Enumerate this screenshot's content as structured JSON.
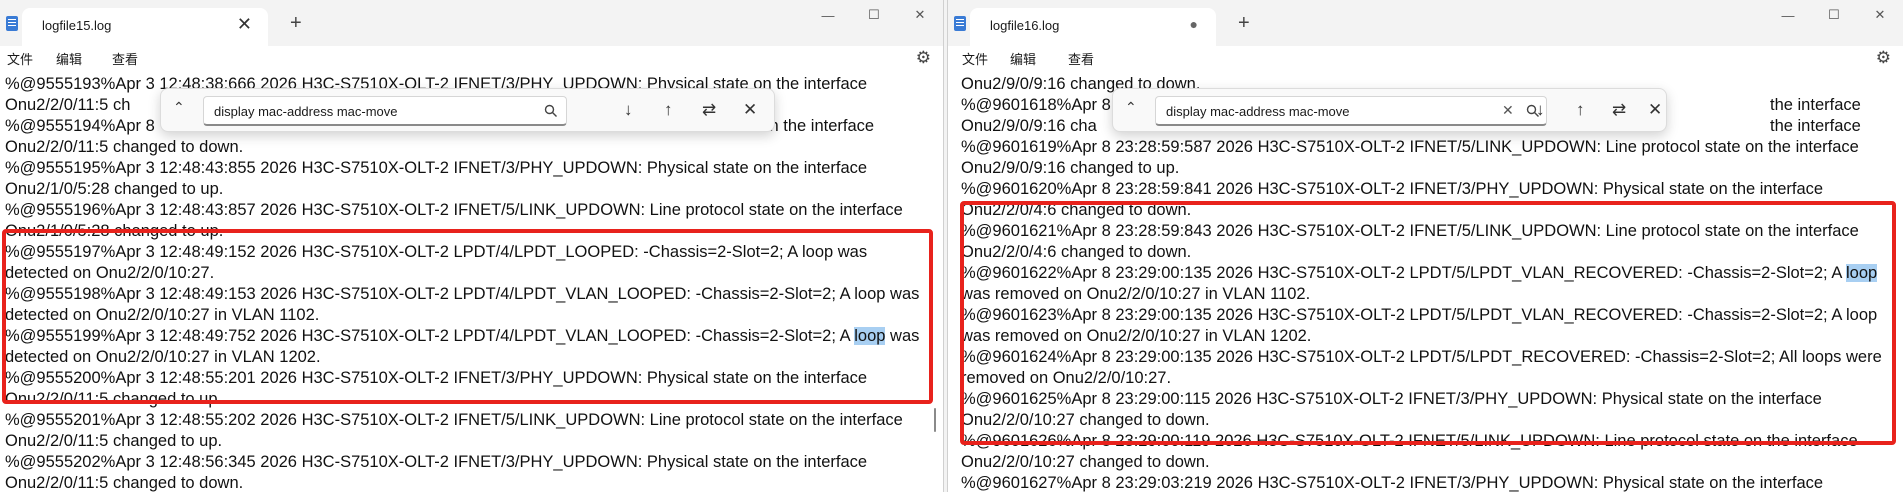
{
  "left": {
    "tab_title": "logfile15.log",
    "tab_close": "✕",
    "new_tab": "+",
    "menu": [
      "文件",
      "编辑",
      "查看"
    ],
    "find_query": "display mac-address mac-move",
    "lines": [
      "%@9555193%Apr  3 12:48:38:666 2026 H3C-S7510X-OLT-2 IFNET/3/PHY_UPDOWN: Physical state on the interface",
      "Onu2/2/0/11:5 ch",
      "%@9555194%Apr  8",
      "Onu2/2/0/11:5 changed to down.",
      "%@9555195%Apr  3 12:48:43:855 2026 H3C-S7510X-OLT-2 IFNET/3/PHY_UPDOWN: Physical state on the interface",
      "Onu2/1/0/5:28 changed to up.",
      "%@9555196%Apr  3 12:48:43:857 2026 H3C-S7510X-OLT-2 IFNET/5/LINK_UPDOWN: Line protocol state on the interface",
      "Onu2/1/0/5:28 changed to up.",
      "%@9555197%Apr  3 12:48:49:152 2026 H3C-S7510X-OLT-2 LPDT/4/LPDT_LOOPED: -Chassis=2-Slot=2; A loop was",
      "detected on Onu2/2/0/10:27.",
      "%@9555198%Apr  3 12:48:49:153 2026 H3C-S7510X-OLT-2 LPDT/4/LPDT_VLAN_LOOPED: -Chassis=2-Slot=2; A loop was",
      "detected on Onu2/2/0/10:27 in VLAN 1102.",
      "%@9555199%Apr  3 12:48:49:752 2026 H3C-S7510X-OLT-2 LPDT/4/LPDT_VLAN_LOOPED: -Chassis=2-Slot=2; A ",
      "loop",
      " was",
      "detected on Onu2/2/0/10:27 in VLAN 1202.",
      "%@9555200%Apr  3 12:48:55:201 2026 H3C-S7510X-OLT-2 IFNET/3/PHY_UPDOWN: Physical state on the interface",
      "Onu2/2/0/11:5 changed to up.",
      "%@9555201%Apr  3 12:48:55:202 2026 H3C-S7510X-OLT-2 IFNET/5/LINK_UPDOWN: Line protocol state on the interface",
      "Onu2/2/0/11:5 changed to up.",
      "%@9555202%Apr  3 12:48:56:345 2026 H3C-S7510X-OLT-2 IFNET/3/PHY_UPDOWN: Physical state on the interface",
      "Onu2/2/0/11:5 changed to down."
    ],
    "partial_after_find": "te on the interface"
  },
  "right": {
    "tab_title": "logfile16.log",
    "tab_dot": "●",
    "new_tab": "+",
    "menu": [
      "文件",
      "编辑",
      "查看"
    ],
    "find_query": "display mac-address mac-move",
    "lines": [
      "Onu2/9/0/9:16 changed to down.",
      "%@9601618%Apr  8",
      "Onu2/9/0/9:16 cha",
      "%@9601619%Apr  8 23:28:59:587 2026 H3C-S7510X-OLT-2 IFNET/5/LINK_UPDOWN: Line protocol state on the interface",
      "Onu2/9/0/9:16 changed to up.",
      "%@9601620%Apr  8 23:28:59:841 2026 H3C-S7510X-OLT-2 IFNET/3/PHY_UPDOWN: Physical state on the interface",
      "Onu2/2/0/4:6 changed to down.",
      "%@9601621%Apr  8 23:28:59:843 2026 H3C-S7510X-OLT-2 IFNET/5/LINK_UPDOWN: Line protocol state on the interface",
      "Onu2/2/0/4:6 changed to down.",
      "%@9601622%Apr  8 23:29:00:135 2026 H3C-S7510X-OLT-2 LPDT/5/LPDT_VLAN_RECOVERED: -Chassis=2-Slot=2; A ",
      "loop",
      "was removed on Onu2/2/0/10:27 in VLAN 1102.",
      "%@9601623%Apr  8 23:29:00:135 2026 H3C-S7510X-OLT-2 LPDT/5/LPDT_VLAN_RECOVERED: -Chassis=2-Slot=2; A loop",
      "was removed on Onu2/2/0/10:27 in VLAN 1202.",
      "%@9601624%Apr  8 23:29:00:135 2026 H3C-S7510X-OLT-2 LPDT/5/LPDT_RECOVERED: -Chassis=2-Slot=2; All loops were",
      "removed on Onu2/2/0/10:27.",
      "%@9601625%Apr  8 23:29:00:115 2026 H3C-S7510X-OLT-2 IFNET/3/PHY_UPDOWN: Physical state on the interface",
      "Onu2/2/0/10:27 changed to down.",
      "%@9601626%Apr  8 23:29:00:119 2026 H3C-S7510X-OLT-2 IFNET/5/LINK_UPDOWN: Line protocol state on the interface",
      "Onu2/2/0/10:27 changed to down.",
      "%@9601627%Apr  8 23:29:03:219 2026 H3C-S7510X-OLT-2 IFNET/3/PHY_UPDOWN: Physical state on the interface"
    ],
    "partial_after_find_1": "the interface",
    "partial_after_find_2": "the interface"
  },
  "colors": {
    "highlight_box": "#e8221c",
    "search_match": "#a8cff2"
  }
}
